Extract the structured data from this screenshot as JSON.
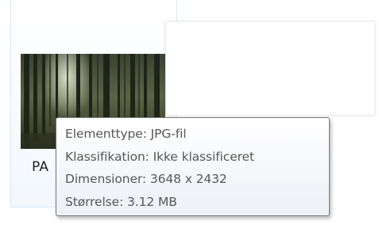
{
  "file": {
    "name": "PA",
    "thumbnail_icon": "forest-photo-thumbnail"
  },
  "tooltip": {
    "lines": [
      "Elementtype: JPG-fil",
      "Klassifikation: Ikke klassificeret",
      "Dimensioner: 3648 x 2432",
      "Størrelse: 3.12 MB"
    ]
  }
}
